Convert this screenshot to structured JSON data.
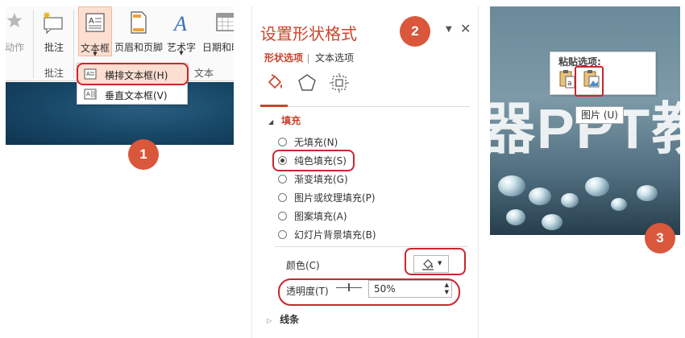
{
  "panel1": {
    "ribbon_buttons": [
      {
        "label": "动作",
        "icon": "star-icon"
      },
      {
        "label": "批注",
        "icon": "comment-icon"
      },
      {
        "label": "文本框",
        "icon": "textbox-icon"
      },
      {
        "label": "页眉和页脚",
        "icon": "header-footer-icon"
      },
      {
        "label": "艺术字",
        "icon": "wordart-icon"
      },
      {
        "label": "日期和时",
        "icon": "date-time-icon"
      }
    ],
    "groups": {
      "comments": "批注",
      "text": "文本"
    },
    "menu_items": [
      {
        "label": "横排文本框(H)",
        "icon": "horizontal-textbox-icon",
        "highlighted": true
      },
      {
        "label": "垂直文本框(V)",
        "icon": "vertical-textbox-icon",
        "highlighted": false
      }
    ],
    "step": "1"
  },
  "panel2": {
    "title": "设置形状格式",
    "step": "2",
    "tabs": [
      "形状选项",
      "文本选项"
    ],
    "section_fill": "填充",
    "fill_options": [
      {
        "label": "无填充(N)",
        "selected": false
      },
      {
        "label": "纯色填充(S)",
        "selected": true
      },
      {
        "label": "渐变填充(G)",
        "selected": false
      },
      {
        "label": "图片或纹理填充(P)",
        "selected": false
      },
      {
        "label": "图案填充(A)",
        "selected": false
      },
      {
        "label": "幻灯片背景填充(B)",
        "selected": false
      }
    ],
    "color_label": "颜色(C)",
    "transparency_label": "透明度(T)",
    "transparency_value": "50%",
    "transparency_percent": 50,
    "section_line": "线条",
    "accent_color": "#c9442b"
  },
  "panel3": {
    "paste_title": "粘贴选项:",
    "tooltip": "图片 (U)",
    "slide_text": "器PPT教",
    "step": "3"
  },
  "colors": {
    "accent": "#c9442b",
    "highlight_box": "#c9262d",
    "step_badge": "#d9573b"
  }
}
